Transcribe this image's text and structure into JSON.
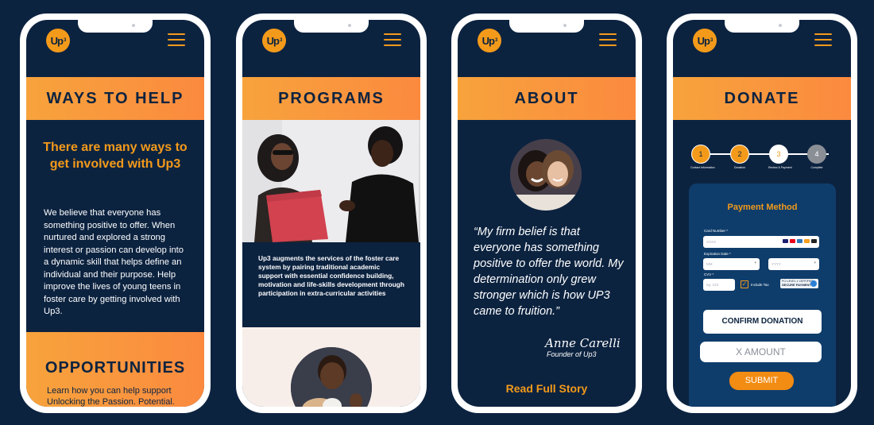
{
  "brand": {
    "logo_text": "Up",
    "logo_sup": "3"
  },
  "colors": {
    "navy": "#0c2340",
    "orange": "#f39a1a",
    "banner_gradient": [
      "#f7a33c",
      "#fb8a3f"
    ]
  },
  "icons": [
    "up3-logo",
    "menu-icon",
    "check-icon",
    "card-brand-icons",
    "chevron-down-icon"
  ],
  "ways_to_help": {
    "banner": "WAYS TO HELP",
    "heading": "There are many ways to get involved with Up3",
    "body": "We believe that everyone has something positive to offer. When nurtured and explored a strong interest or passion can develop into a dynamic skill that helps define an individual and their purpose. Help improve the lives of young teens in foster care by getting involved with Up3.",
    "opportunities_title": "OPPORTUNITIES",
    "opportunities_text": "Learn how you can help support Unlocking the Passion. Potential."
  },
  "programs": {
    "banner": "PROGRAMS",
    "body": "Up3 augments the services of the foster care system by pairing traditional academic support with essential confidence building, motivation and life-skills development through participation in extra-curricular activities"
  },
  "about": {
    "banner": "ABOUT",
    "quote": "“My firm belief is that everyone has something positive to offer the world. My determination only grew stronger which is how UP3 came to fruition.”",
    "signature": "Anne Carelli",
    "signature_title": "Founder of Up3",
    "read_more": "Read Full Story"
  },
  "donate": {
    "banner": "DONATE",
    "steps": [
      {
        "num": "1",
        "label": "Contact Information",
        "state": "done"
      },
      {
        "num": "2",
        "label": "Donation",
        "state": "done"
      },
      {
        "num": "3",
        "label": "Review & Payment",
        "state": "active"
      },
      {
        "num": "4",
        "label": "Complete",
        "state": "pending"
      }
    ],
    "payment_title": "Payment Method",
    "card_number_label": "Card Number *",
    "card_number_placeholder": "XXXX",
    "expiration_label": "Expiration Date *",
    "exp_month_placeholder": "MM",
    "exp_year_placeholder": "YYYY",
    "cvv_label": "CVV *",
    "cvv_placeholder": "eg. 123",
    "include_tax_label": "Include Tax",
    "secure_line1": "PCI LEVEL 1 CERTIFIED",
    "secure_line2": "SECURE PAYMENT",
    "confirm_button": "CONFIRM DONATION",
    "amount_placeholder": "X AMOUNT",
    "submit_button": "SUBMIT"
  }
}
